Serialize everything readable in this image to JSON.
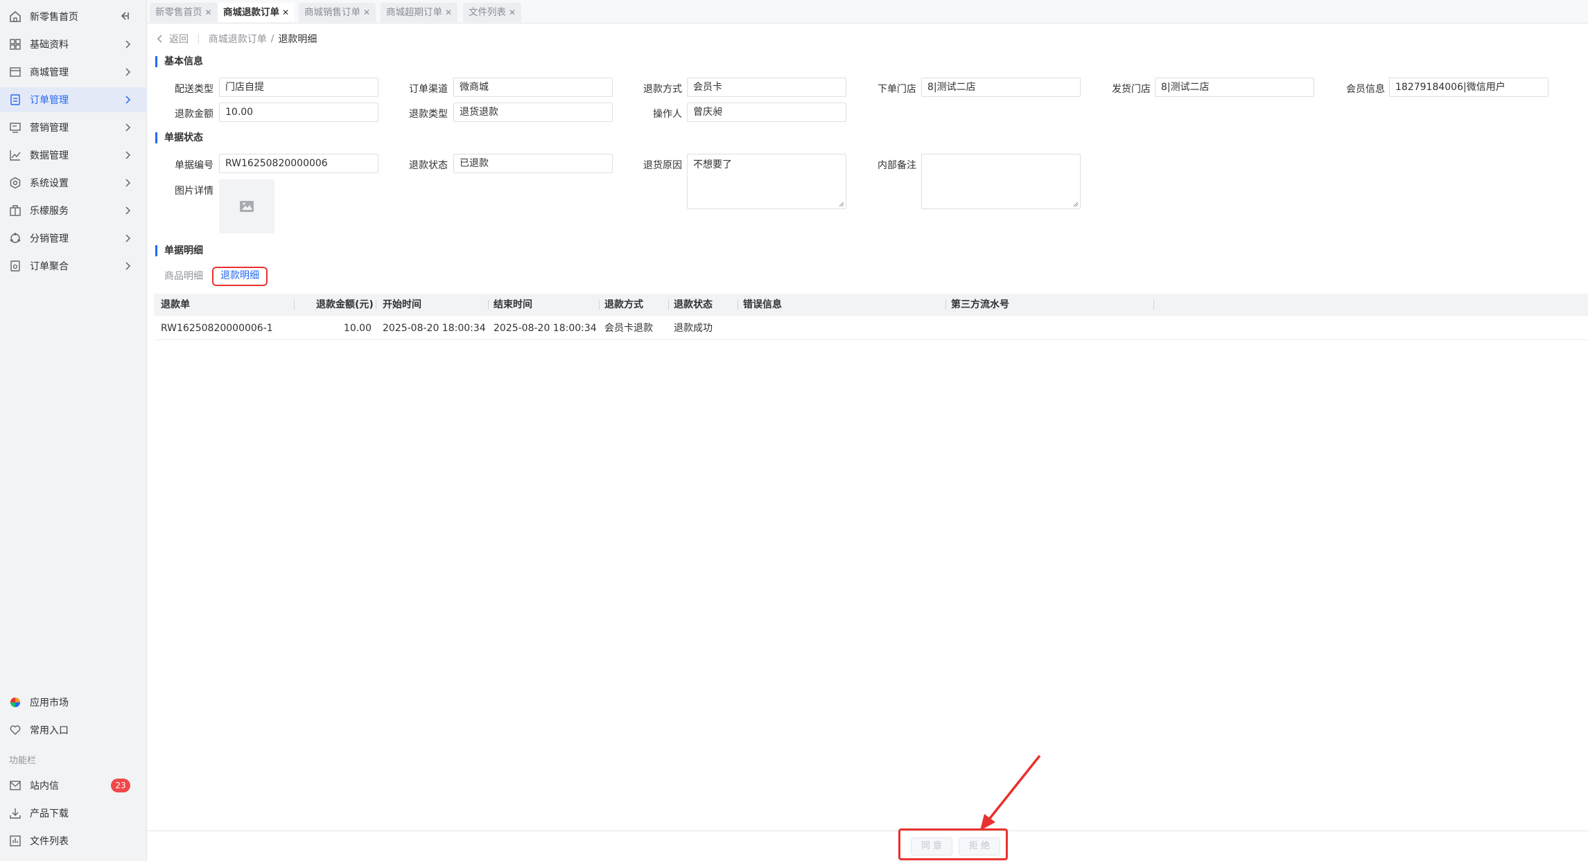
{
  "sidebar": {
    "items": [
      {
        "label": "新零售首页",
        "icon": "home-icon"
      },
      {
        "label": "基础资料",
        "icon": "grid-icon"
      },
      {
        "label": "商城管理",
        "icon": "shop-icon"
      },
      {
        "label": "订单管理",
        "icon": "order-icon"
      },
      {
        "label": "营销管理",
        "icon": "marketing-icon"
      },
      {
        "label": "数据管理",
        "icon": "chart-icon"
      },
      {
        "label": "系统设置",
        "icon": "settings-icon"
      },
      {
        "label": "乐檬服务",
        "icon": "service-icon"
      },
      {
        "label": "分销管理",
        "icon": "distribution-icon"
      },
      {
        "label": "订单聚合",
        "icon": "aggregate-icon"
      }
    ],
    "bottom": {
      "app_market": "应用市场",
      "favorites": "常用入口",
      "section_label": "功能栏",
      "messages": "站内信",
      "messages_badge": "23",
      "downloads": "产品下载",
      "files": "文件列表"
    }
  },
  "tabs": [
    {
      "label": "新零售首页"
    },
    {
      "label": "商城退款订单"
    },
    {
      "label": "商城销售订单"
    },
    {
      "label": "商城超期订单"
    },
    {
      "label": "文件列表"
    }
  ],
  "breadcrumb": {
    "back": "返回",
    "parent": "商城退款订单",
    "separator": "/",
    "current": "退款明细"
  },
  "basic_info": {
    "title": "基本信息",
    "delivery_type": {
      "label": "配送类型",
      "value": "门店自提"
    },
    "order_channel": {
      "label": "订单渠道",
      "value": "微商城"
    },
    "refund_method": {
      "label": "退款方式",
      "value": "会员卡"
    },
    "order_store": {
      "label": "下单门店",
      "value": "8|测试二店"
    },
    "ship_store": {
      "label": "发货门店",
      "value": "8|测试二店"
    },
    "member_info": {
      "label": "会员信息",
      "value": "18279184006|微信用户"
    },
    "refund_amount": {
      "label": "退款金额",
      "value": "10.00"
    },
    "refund_type": {
      "label": "退款类型",
      "value": "退货退款"
    },
    "operator": {
      "label": "操作人",
      "value": "曾庆昶"
    }
  },
  "doc_status": {
    "title": "单据状态",
    "doc_no": {
      "label": "单据编号",
      "value": "RW16250820000006"
    },
    "refund_status": {
      "label": "退款状态",
      "value": "已退款"
    },
    "return_reason": {
      "label": "退货原因",
      "value": "不想要了"
    },
    "internal_note": {
      "label": "内部备注",
      "value": ""
    },
    "images": {
      "label": "图片详情"
    }
  },
  "detail": {
    "title": "单据明细",
    "subtabs": [
      "商品明细",
      "退款明细"
    ],
    "columns": [
      "退款单",
      "退款金额(元)",
      "开始时间",
      "结束时间",
      "退款方式",
      "退款状态",
      "错误信息",
      "第三方流水号"
    ],
    "rows": [
      [
        "RW16250820000006-1",
        "10.00",
        "2025-08-20 18:00:34",
        "2025-08-20 18:00:34",
        "会员卡退款",
        "退款成功",
        "",
        ""
      ]
    ]
  },
  "actions": {
    "agree": "同 意",
    "reject": "拒 绝"
  },
  "colors": {
    "accent": "#2468f2",
    "highlight": "#e8322f",
    "badge": "#f0484a"
  }
}
